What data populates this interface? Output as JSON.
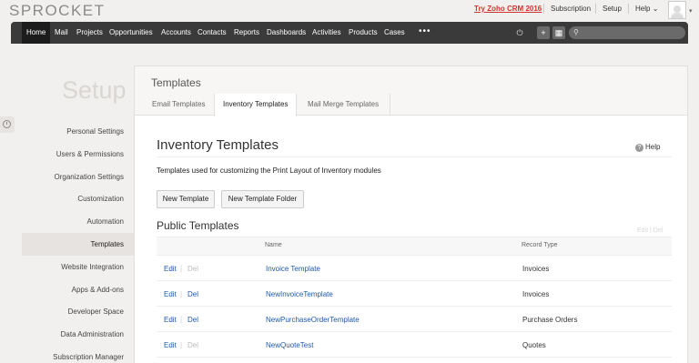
{
  "brand": {
    "logo_text": "SPROCKET",
    "accent": "#d1322b",
    "link_color": "#1f5aa6",
    "nav_bg": "#3a3a3a"
  },
  "topbar": {
    "try_link": "Try Zoho CRM 2016",
    "subscription": "Subscription",
    "setup": "Setup",
    "help": "Help",
    "help_caret": "⌄"
  },
  "nav": {
    "items": [
      "Home",
      "Mail",
      "Projects",
      "Opportunities",
      "Accounts",
      "Contacts",
      "Reports",
      "Dashboards",
      "Activities",
      "Products",
      "Cases"
    ],
    "more": "•••",
    "icons": [
      "plug-icon",
      "add-icon",
      "calendar-icon",
      "search-icon"
    ]
  },
  "sidebar": {
    "title": "Setup",
    "items": [
      "Personal Settings",
      "Users & Permissions",
      "Organization Settings",
      "Customization",
      "Automation",
      "Templates",
      "Website Integration",
      "Apps & Add-ons",
      "Developer Space",
      "Data Administration",
      "Subscription Manager"
    ],
    "active": "Templates"
  },
  "panel": {
    "title": "Templates",
    "tabs": [
      "Email Templates",
      "Inventory Templates",
      "Mail Merge Templates"
    ],
    "active_tab": "Inventory Templates"
  },
  "content": {
    "heading": "Inventory Templates",
    "help": "Help",
    "description": "Templates used for customizing the Print Layout of Inventory modules",
    "buttons": {
      "new_template": "New Template",
      "new_folder": "New Template Folder"
    },
    "section_title": "Public Templates",
    "faint_actions": {
      "edit": "Edit",
      "sep": "|",
      "del": "Del"
    }
  },
  "table": {
    "columns": [
      "Name",
      "Record Type"
    ],
    "rows": [
      {
        "edit": "Edit",
        "sep": "|",
        "del": "Del",
        "del_enabled": false,
        "name": "Invoice Template",
        "record_type": "Invoices"
      },
      {
        "edit": "Edit",
        "sep": "|",
        "del": "Del",
        "del_enabled": true,
        "name": "NewInvoiceTemplate",
        "record_type": "Invoices"
      },
      {
        "edit": "Edit",
        "sep": "|",
        "del": "Del",
        "del_enabled": true,
        "name": "NewPurchaseOrderTemplate",
        "record_type": "Purchase Orders"
      },
      {
        "edit": "Edit",
        "sep": "|",
        "del": "Del",
        "del_enabled": false,
        "name": "NewQuoteTest",
        "record_type": "Quotes"
      }
    ]
  }
}
